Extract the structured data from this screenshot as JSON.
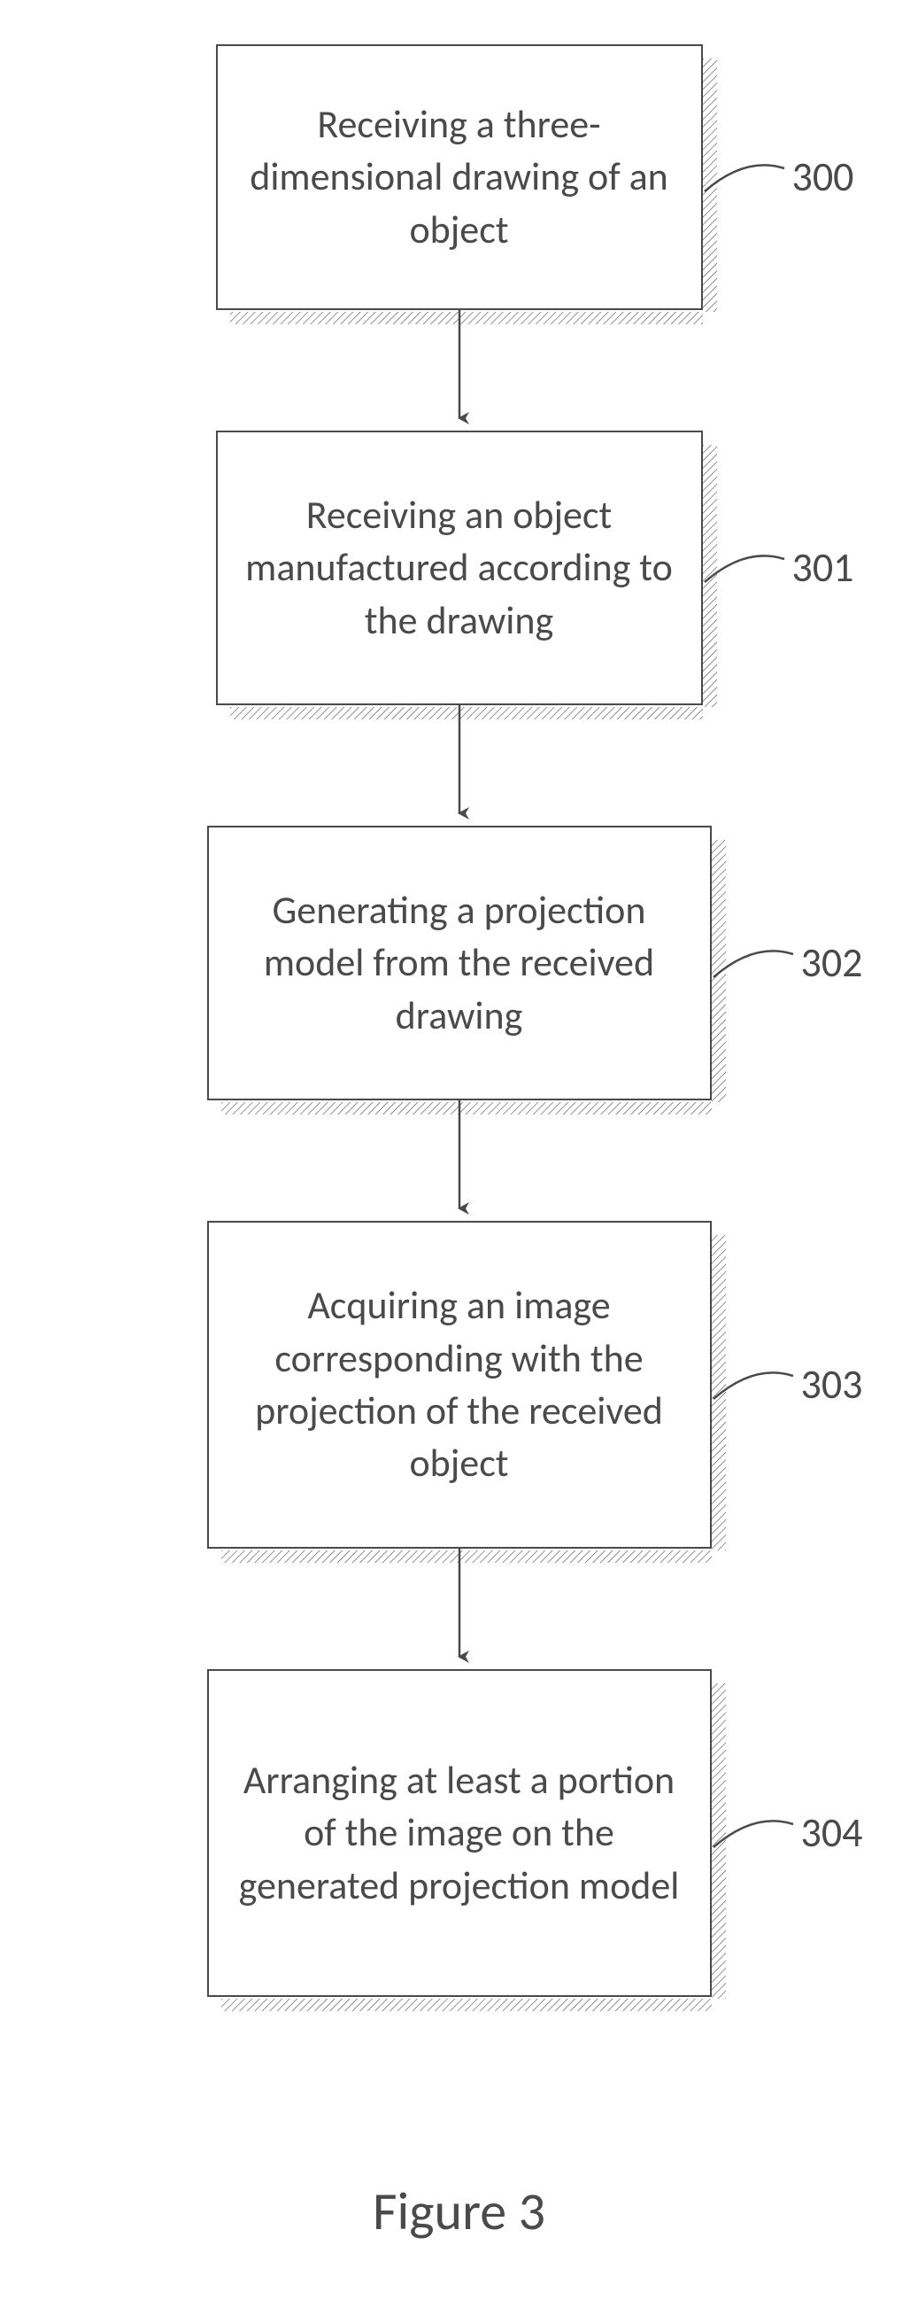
{
  "figure_title": "Figure 3",
  "steps": [
    {
      "ref": "300",
      "text": "Receiving a three-dimensional drawing of an object"
    },
    {
      "ref": "301",
      "text": "Receiving an object manufactured according to the drawing"
    },
    {
      "ref": "302",
      "text": "Generating a projection model from the received drawing"
    },
    {
      "ref": "303",
      "text": "Acquiring an image corresponding with the projection of the received object"
    },
    {
      "ref": "304",
      "text": "Arranging at least a portion of the image on the generated projection model"
    }
  ],
  "hatch": {
    "angle_deg": 45,
    "spacing": 5,
    "stroke": "#4a4a4a",
    "stroke_width": 1
  }
}
